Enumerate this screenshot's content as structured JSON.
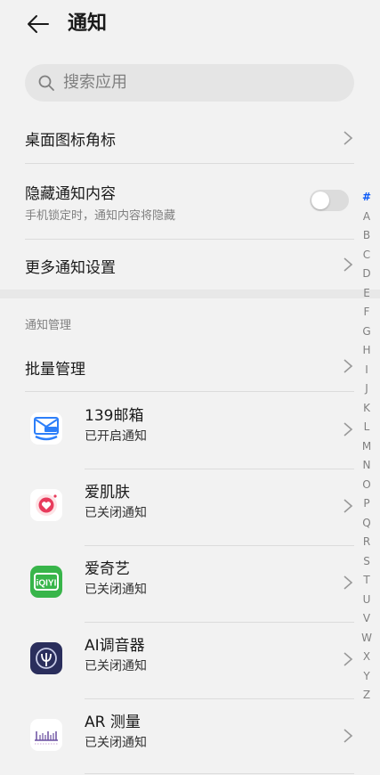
{
  "header": {
    "title": "通知"
  },
  "search": {
    "placeholder": "搜索应用"
  },
  "settings": {
    "badge": {
      "label": "桌面图标角标"
    },
    "hide": {
      "label": "隐藏通知内容",
      "sub": "手机锁定时，通知内容将隐藏",
      "toggle": "off"
    },
    "more": {
      "label": "更多通知设置"
    }
  },
  "manage": {
    "section_label": "通知管理",
    "batch_label": "批量管理"
  },
  "apps": [
    {
      "name": "139邮箱",
      "status": "已开启通知",
      "icon": "mail-139-icon"
    },
    {
      "name": "爱肌肤",
      "status": "已关闭通知",
      "icon": "heart-icon"
    },
    {
      "name": "爱奇艺",
      "status": "已关闭通知",
      "icon": "iqiyi-icon"
    },
    {
      "name": "AI调音器",
      "status": "已关闭通知",
      "icon": "tuner-icon"
    },
    {
      "name": "AR 测量",
      "status": "已关闭通知",
      "icon": "ruler-icon"
    }
  ],
  "alphabet": [
    "#",
    "A",
    "B",
    "C",
    "D",
    "E",
    "F",
    "G",
    "H",
    "I",
    "J",
    "K",
    "L",
    "M",
    "N",
    "O",
    "P",
    "Q",
    "R",
    "S",
    "T",
    "U",
    "V",
    "W",
    "X",
    "Y",
    "Z"
  ],
  "colors": {
    "accent": "#0a59f7",
    "background": "#f2f2f2",
    "secondary_text": "#808080"
  }
}
